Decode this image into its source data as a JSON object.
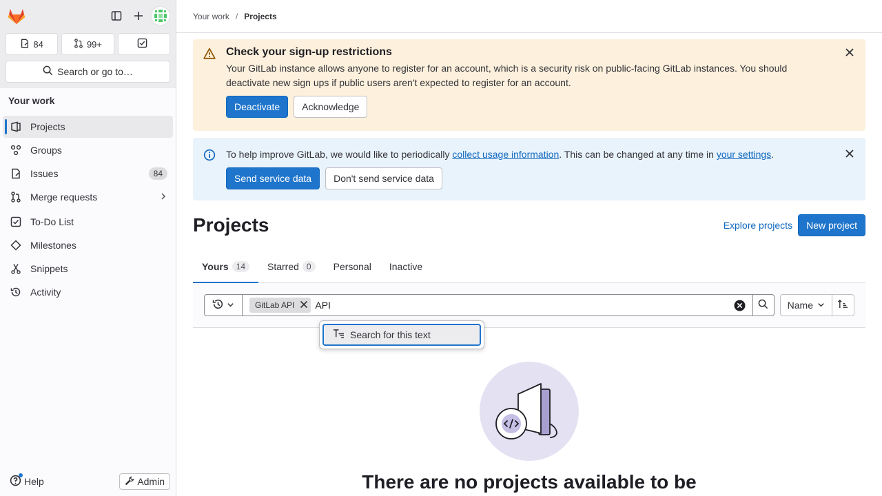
{
  "sidebar": {
    "counters": [
      {
        "icon": "issues-icon",
        "value": "84"
      },
      {
        "icon": "merge-request-icon",
        "value": "99+"
      },
      {
        "icon": "todo-icon",
        "value": ""
      }
    ],
    "search_label": "Search or go to…",
    "section_title": "Your work",
    "items": [
      {
        "label": "Projects",
        "icon": "project-icon",
        "active": true
      },
      {
        "label": "Groups",
        "icon": "group-icon"
      },
      {
        "label": "Issues",
        "icon": "issues-icon",
        "badge": "84"
      },
      {
        "label": "Merge requests",
        "icon": "merge-request-icon"
      },
      {
        "label": "To-Do List",
        "icon": "todo-icon"
      },
      {
        "label": "Milestones",
        "icon": "milestone-icon"
      },
      {
        "label": "Snippets",
        "icon": "snippet-icon"
      },
      {
        "label": "Activity",
        "icon": "history-icon"
      }
    ],
    "help_label": "Help",
    "admin_label": "Admin"
  },
  "breadcrumb": {
    "parent": "Your work",
    "separator": "/",
    "current": "Projects"
  },
  "alerts": {
    "signup": {
      "title": "Check your sign-up restrictions",
      "body": "Your GitLab instance allows anyone to register for an account, which is a security risk on public-facing GitLab instances. You should deactivate new sign ups if public users aren't expected to register for an account.",
      "primary": "Deactivate",
      "secondary": "Acknowledge"
    },
    "usage": {
      "text_1": "To help improve GitLab, we would like to periodically ",
      "link_1": "collect usage information",
      "text_2": ". This can be changed at any time in ",
      "link_2": "your settings",
      "text_3": ".",
      "primary": "Send service data",
      "secondary": "Don't send service data"
    }
  },
  "page": {
    "title": "Projects",
    "explore_label": "Explore projects",
    "new_label": "New project"
  },
  "tabs": [
    {
      "label": "Yours",
      "count": "14",
      "active": true
    },
    {
      "label": "Starred",
      "count": "0"
    },
    {
      "label": "Personal"
    },
    {
      "label": "Inactive"
    }
  ],
  "filter": {
    "token_label": "GitLab API",
    "text": "API",
    "sort_label": "Name"
  },
  "dropdown": {
    "item_label": "Search for this text"
  },
  "empty_state": {
    "title": "There are no projects available to be"
  },
  "colors": {
    "accent": "#1f75cb",
    "warning_bg": "#fdf1dd",
    "info_bg": "#e9f3fc"
  }
}
